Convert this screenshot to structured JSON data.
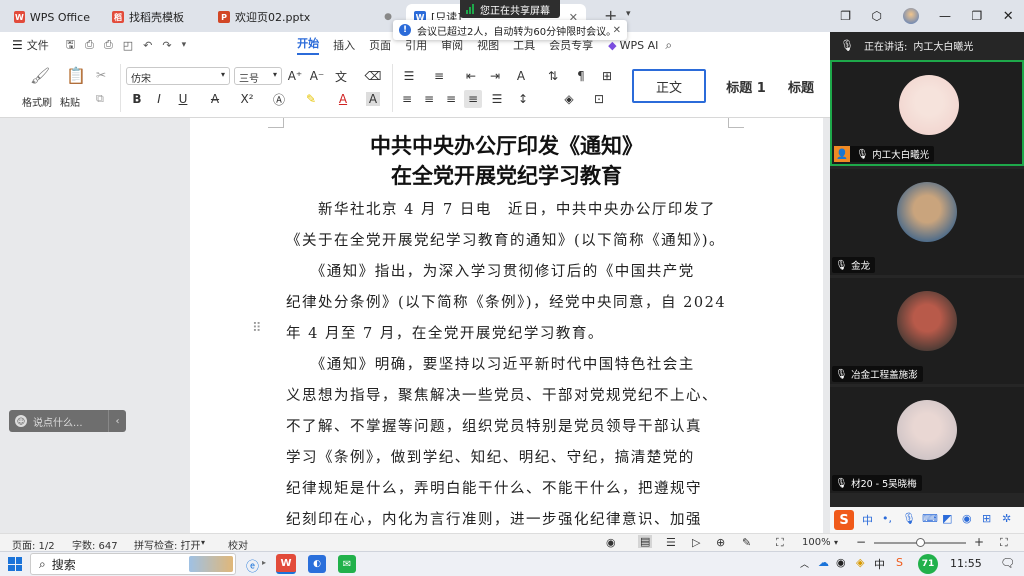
{
  "tabs": [
    {
      "label": "WPS Office",
      "color": "#e24b3b",
      "letter": "W"
    },
    {
      "label": "找稻壳模板",
      "color": "#e24b3b",
      "letter": "稻"
    },
    {
      "label": "欢迎页02.pptx",
      "color": "#d24726",
      "letter": "P"
    },
    {
      "label": "[只读]",
      "color": "#2b6bd9",
      "letter": "W"
    }
  ],
  "share_banner": "您正在共享屏幕",
  "notice": "会议已超过2人，自动转为60分钟限时会议。",
  "menu": {
    "file": "文件",
    "items": [
      "开始",
      "插入",
      "页面",
      "引用",
      "审阅",
      "视图",
      "工具",
      "会员专享"
    ],
    "active": "开始",
    "ai": "WPS AI"
  },
  "ribbon": {
    "format_painter": "格式刷",
    "paste": "粘贴",
    "font": "仿宋",
    "size": "三号",
    "style_normal": "正文",
    "style_h1": "标题  1",
    "style_h2": "标题"
  },
  "document": {
    "title_line1": "中共中央办公厅印发《通知》",
    "title_line2": "在全党开展党纪学习教育",
    "lines": [
      "　　新华社北京 4 月 7 日电　近日，中共中央办公厅印发了",
      "《关于在全党开展党纪学习教育的通知》(以下简称《通知》)。",
      "　　《通知》指出，为深入学习贯彻修订后的《中国共产党",
      "纪律处分条例》(以下简称《条例》)，经党中央同意，自 2024",
      "年 4 月至 7 月，在全党开展党纪学习教育。",
      "　　《通知》明确，要坚持以习近平新时代中国特色社会主",
      "义思想为指导，聚焦解决一些党员、干部对党规党纪不上心、",
      "不了解、不掌握等问题，组织党员特别是党员领导干部认真",
      "学习《条例》，做到学纪、知纪、明纪、守纪，搞清楚党的",
      "纪律规矩是什么，弄明白能干什么、不能干什么，把遵规守",
      "纪刻印在心，内化为言行准则，进一步强化纪律意识、加强"
    ]
  },
  "chat_input_placeholder": "说点什么...",
  "status": {
    "page": "页面: 1/2",
    "words": "字数: 647",
    "spell": "拼写检查: 打开",
    "proof": "校对",
    "zoom": "100%"
  },
  "meeting": {
    "speaking_label": "正在讲话:",
    "speaking_name": "内工大白曦光",
    "participants": [
      {
        "name": "内工大白曦光",
        "bg": "#f2d6d0",
        "face": "#f6e3dc"
      },
      {
        "name": "金龙",
        "bg": "#4a6a8a",
        "face": "#c9a47d"
      },
      {
        "name": "冶金工程盖施澎",
        "bg": "#4b3b35",
        "face": "#b85a4a"
      },
      {
        "name": "材20 - 5吴晓梅",
        "bg": "#cfc4c6",
        "face": "#e9d7d3"
      }
    ]
  },
  "taskbar": {
    "search": "搜索",
    "time": "11:55",
    "badge": "71"
  },
  "colors": {
    "accent": "#2b6bd9",
    "share_green": "#1ea84a",
    "wps_red": "#e24b3b"
  }
}
